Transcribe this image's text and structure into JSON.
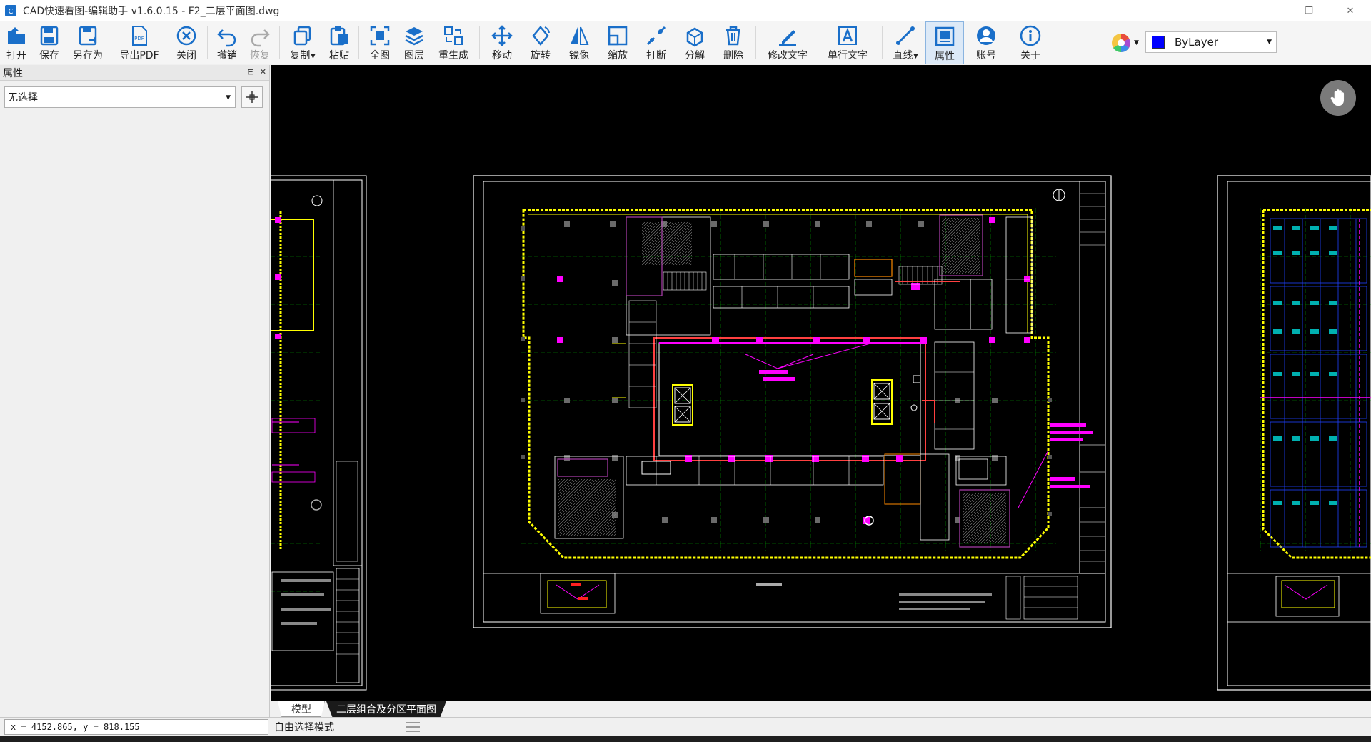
{
  "window": {
    "title": "CAD快速看图-编辑助手 v1.6.0.15 - F2_二层平面图.dwg",
    "minimize_glyph": "—",
    "restore_glyph": "❐",
    "close_glyph": "✕"
  },
  "toolbar": {
    "open": "打开",
    "save": "保存",
    "save_as": "另存为",
    "export_pdf": "导出PDF",
    "close": "关闭",
    "undo": "撤销",
    "redo": "恢复",
    "copy": "复制",
    "paste": "粘贴",
    "fit_all": "全图",
    "layers": "图层",
    "regenerate": "重生成",
    "move": "移动",
    "rotate": "旋转",
    "mirror": "镜像",
    "scale": "缩放",
    "break": "打断",
    "explode": "分解",
    "delete": "删除",
    "edit_text": "修改文字",
    "single_line_text": "单行文字",
    "line": "直线",
    "properties": "属性",
    "account": "账号",
    "about": "关于",
    "pdf_badge": "PDF"
  },
  "layer_select": {
    "value": "ByLayer",
    "swatch_color": "#0000ff"
  },
  "panel": {
    "title": "属性",
    "pin_glyph": "⊟",
    "close_glyph": "✕",
    "selection": "无选择"
  },
  "tabs": {
    "model": "模型",
    "layout": "二层组合及分区平面图"
  },
  "status": {
    "coords": "x = 4152.865, y = 818.155",
    "mode": "自由选择模式"
  },
  "colors": {
    "accent": "#1a6fc9",
    "cad_background": "#000000",
    "cad_yellow": "#ffff00",
    "cad_magenta": "#ff00ff",
    "cad_green": "#00c000",
    "cad_white": "#ffffff"
  },
  "icons": {
    "hand": "pan-hand-icon",
    "color_wheel": "color-wheel-icon",
    "pick": "crosshair-icon"
  }
}
